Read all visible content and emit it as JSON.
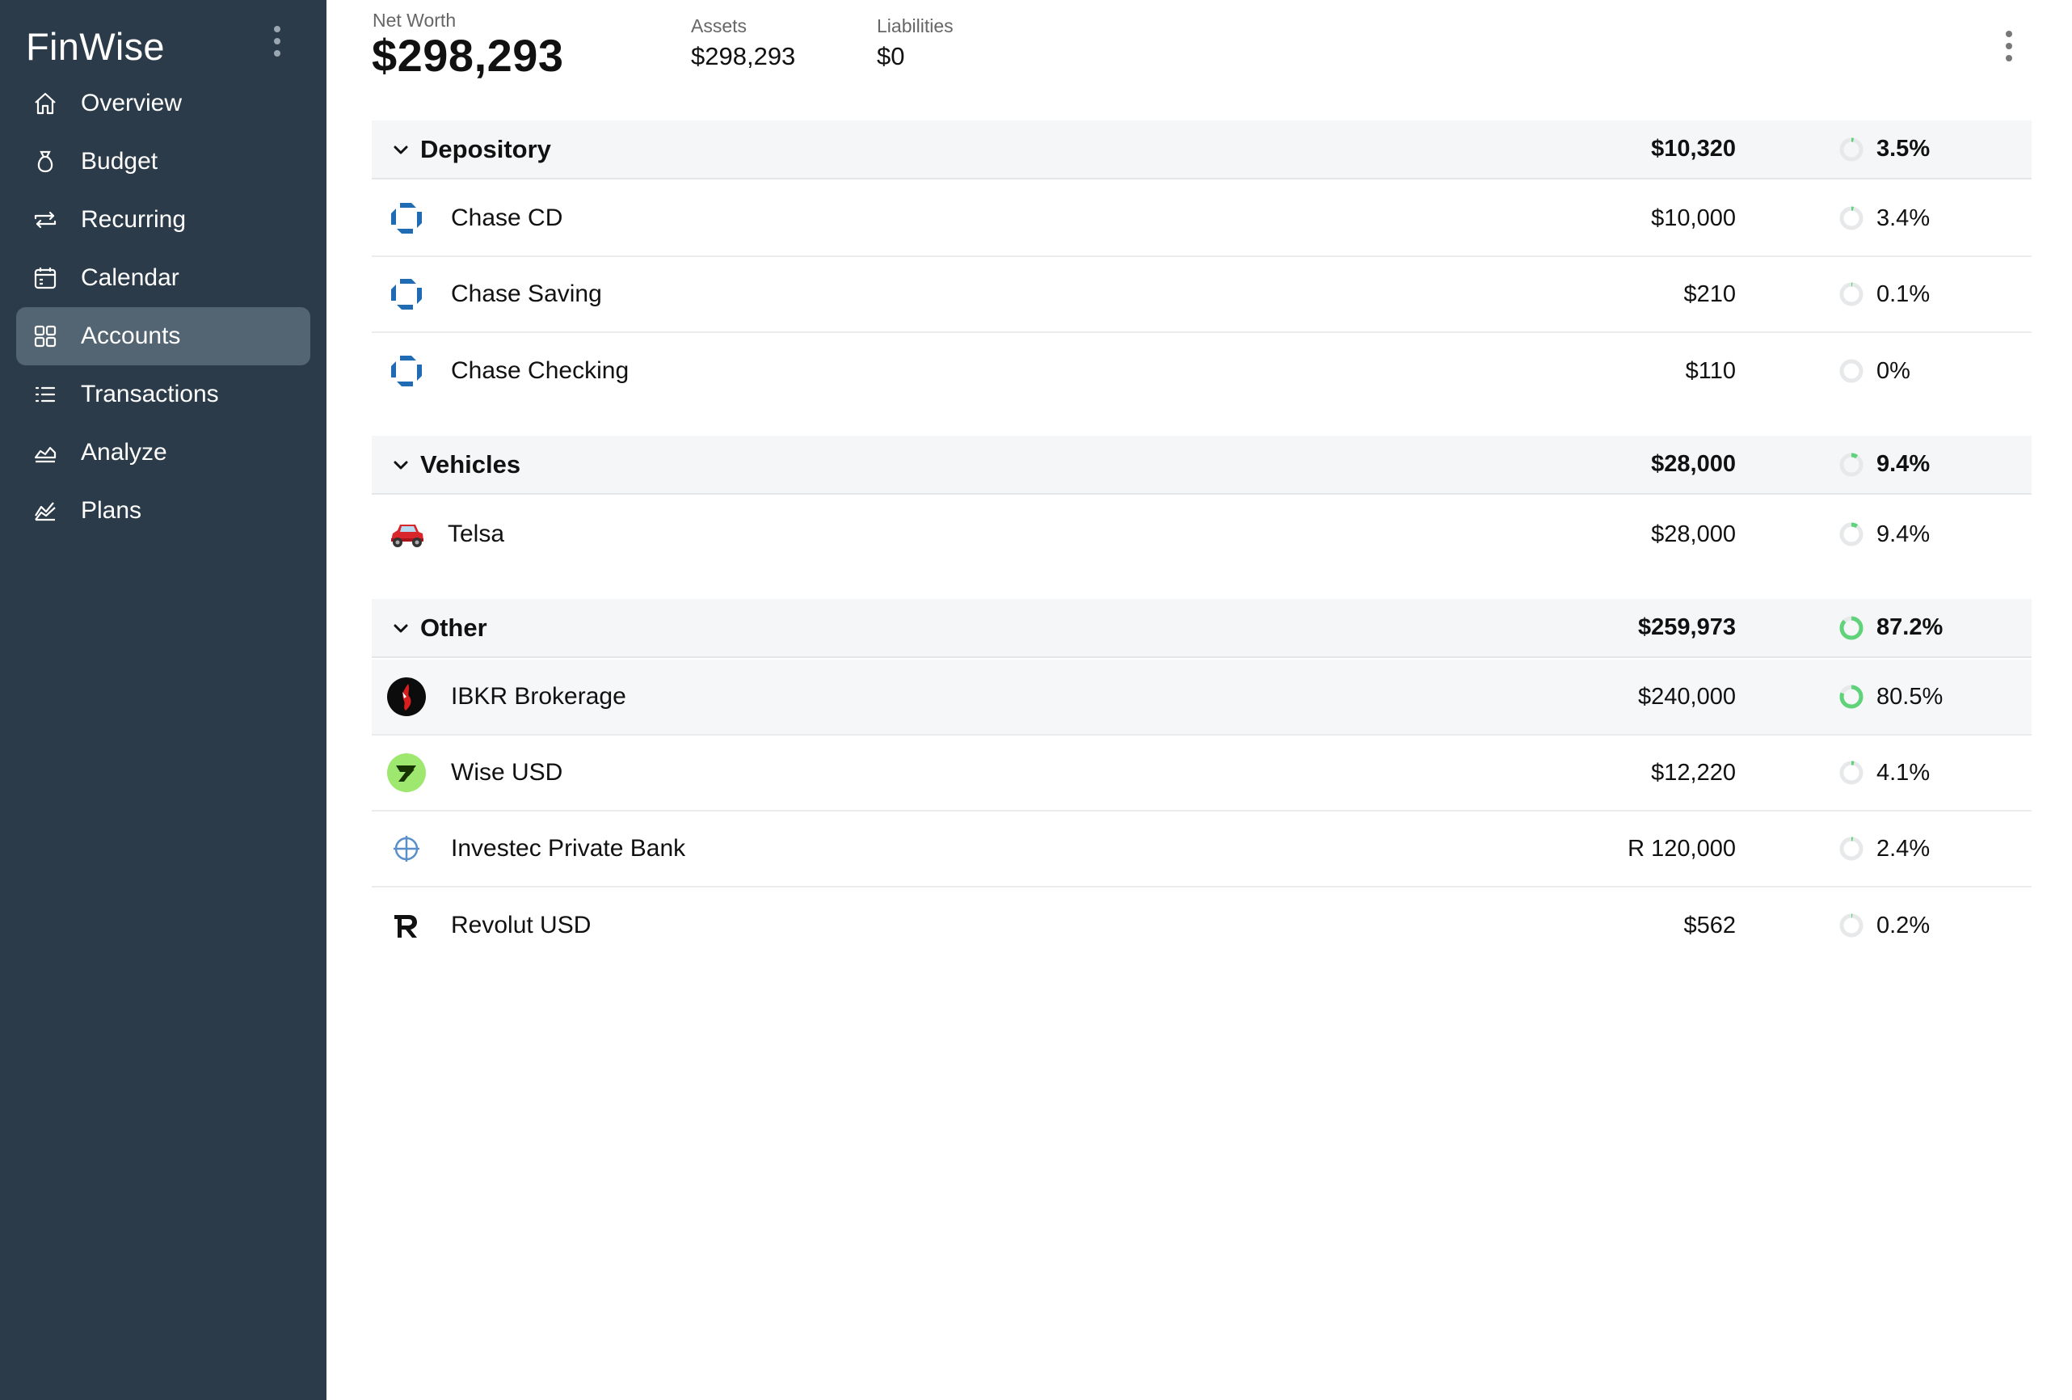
{
  "app": {
    "title": "FinWise"
  },
  "sidebar": {
    "items": [
      {
        "label": "Overview",
        "icon": "home-icon",
        "active": false
      },
      {
        "label": "Budget",
        "icon": "money-bag-icon",
        "active": false
      },
      {
        "label": "Recurring",
        "icon": "repeat-icon",
        "active": false
      },
      {
        "label": "Calendar",
        "icon": "calendar-icon",
        "active": false
      },
      {
        "label": "Accounts",
        "icon": "grid-icon",
        "active": true
      },
      {
        "label": "Transactions",
        "icon": "list-icon",
        "active": false
      },
      {
        "label": "Analyze",
        "icon": "area-chart-icon",
        "active": false
      },
      {
        "label": "Plans",
        "icon": "trend-chart-icon",
        "active": false
      }
    ]
  },
  "header": {
    "net_worth_label": "Net Worth",
    "net_worth_value": "$298,293",
    "assets_label": "Assets",
    "assets_value": "$298,293",
    "liabilities_label": "Liabilities",
    "liabilities_value": "$0"
  },
  "groups": [
    {
      "name": "Depository",
      "amount": "$10,320",
      "percent": "3.5%",
      "share": 0.035,
      "accounts": [
        {
          "name": "Chase CD",
          "amount": "$10,000",
          "percent": "3.4%",
          "share": 0.034,
          "logo": "chase-logo"
        },
        {
          "name": "Chase Saving",
          "amount": "$210",
          "percent": "0.1%",
          "share": 0.001,
          "logo": "chase-logo"
        },
        {
          "name": "Chase Checking",
          "amount": "$110",
          "percent": "0%",
          "share": 0.0,
          "logo": "chase-logo"
        }
      ]
    },
    {
      "name": "Vehicles",
      "amount": "$28,000",
      "percent": "9.4%",
      "share": 0.094,
      "accounts": [
        {
          "name": "Telsa",
          "amount": "$28,000",
          "percent": "9.4%",
          "share": 0.094,
          "logo": "car-emoji-icon"
        }
      ]
    },
    {
      "name": "Other",
      "amount": "$259,973",
      "percent": "87.2%",
      "share": 0.872,
      "accounts": [
        {
          "name": "IBKR Brokerage",
          "amount": "$240,000",
          "percent": "80.5%",
          "share": 0.805,
          "logo": "ibkr-logo"
        },
        {
          "name": "Wise USD",
          "amount": "$12,220",
          "percent": "4.1%",
          "share": 0.041,
          "logo": "wise-logo"
        },
        {
          "name": "Investec Private Bank",
          "amount": "R 120,000",
          "percent": "2.4%",
          "share": 0.024,
          "logo": "investec-logo"
        },
        {
          "name": "Revolut USD",
          "amount": "$562",
          "percent": "0.2%",
          "share": 0.002,
          "logo": "revolut-logo"
        }
      ]
    }
  ],
  "colors": {
    "sidebar_bg": "#2b3b4a",
    "sidebar_active": "#536473",
    "ring_track": "#e6e8ea",
    "ring_fill": "#5fd37a",
    "chase_blue": "#1f6cb5",
    "wise_green": "#9fe870",
    "ibkr_red": "#d81e1e"
  }
}
